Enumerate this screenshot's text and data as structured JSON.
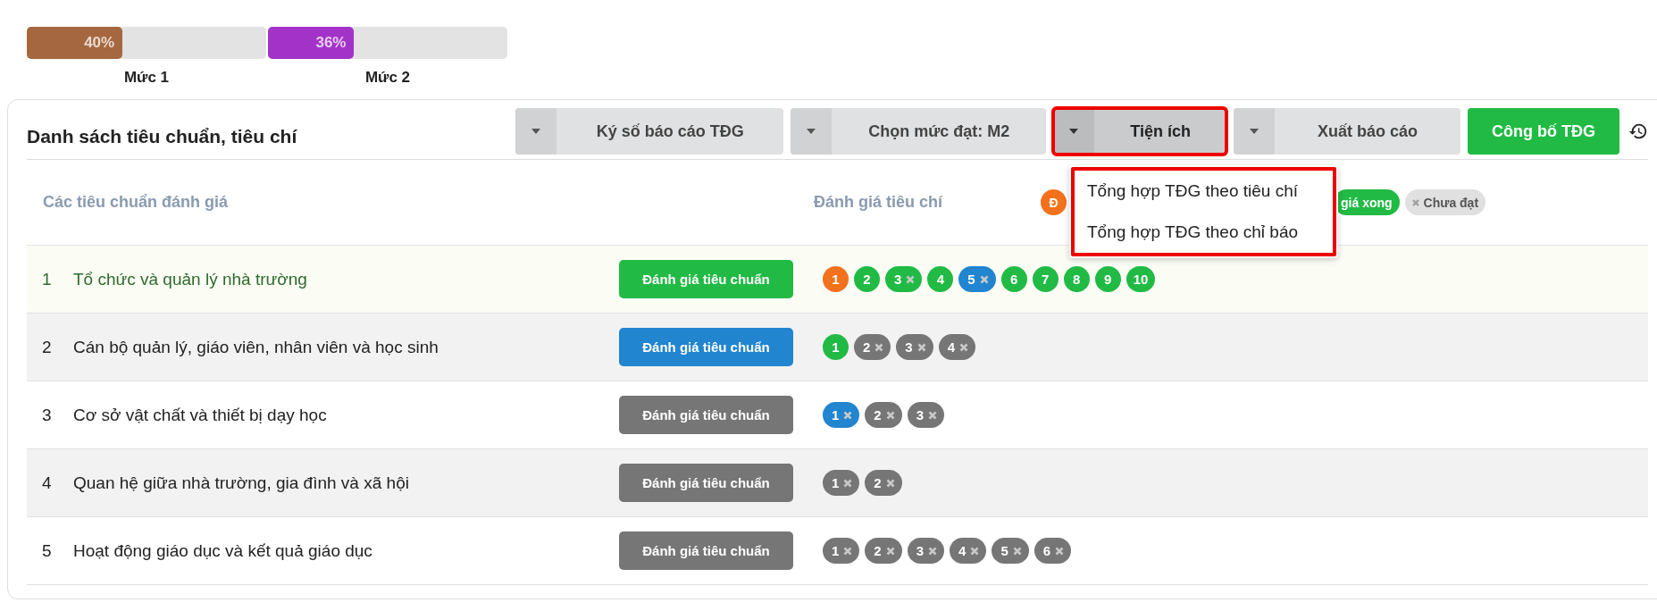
{
  "levels": [
    {
      "value": "40%",
      "level": 0.4,
      "color": "#a5673f",
      "label": "Mức 1"
    },
    {
      "value": "36%",
      "level": 0.36,
      "color": "#a333c8",
      "label": "Mức 2"
    }
  ],
  "panel": {
    "title": "Danh sách tiêu chuẩn, tiêu chí",
    "toolbar": [
      {
        "kind": "split",
        "label": "Ký số báo cáo TĐG",
        "expanded": false,
        "highlighted": false
      },
      {
        "kind": "split",
        "label": "Chọn mức đạt: M2",
        "expanded": false,
        "highlighted": false
      },
      {
        "kind": "split",
        "label": "Tiện ích",
        "expanded": true,
        "highlighted": true
      },
      {
        "kind": "split",
        "label": "Xuất báo cáo",
        "expanded": false,
        "highlighted": false
      },
      {
        "kind": "primary",
        "label": "Công bố TĐG"
      }
    ],
    "menu": {
      "highlighted": true,
      "items": [
        "Tổng hợp TĐG theo tiêu chí",
        "Tổng hợp TĐG theo chỉ báo"
      ]
    },
    "columns": [
      "Các tiêu chuẩn đánh giá",
      "Đánh giá tiêu chí"
    ],
    "legend": [
      {
        "label": "Đ",
        "color": "#f2711c",
        "crossed": false
      },
      {
        "label": "giá xong",
        "color": "#21ba45",
        "crossed": false
      },
      {
        "label": "Chưa đạt",
        "color": "#e0e0e0",
        "crossed": true
      }
    ],
    "rows": [
      {
        "index": "1",
        "name": "Tổ chức và quản lý nhà trường",
        "selected": true,
        "button": {
          "label": "Đánh giá tiêu chuẩn",
          "color": "#21ba45"
        },
        "criteria": [
          {
            "label": "1",
            "color": "#f2711c",
            "crossed": false
          },
          {
            "label": "2",
            "color": "#21ba45",
            "crossed": false
          },
          {
            "label": "3",
            "color": "#21ba45",
            "crossed": true
          },
          {
            "label": "4",
            "color": "#21ba45",
            "crossed": false
          },
          {
            "label": "5",
            "color": "#2185d0",
            "crossed": true
          },
          {
            "label": "6",
            "color": "#21ba45",
            "crossed": false
          },
          {
            "label": "7",
            "color": "#21ba45",
            "crossed": false
          },
          {
            "label": "8",
            "color": "#21ba45",
            "crossed": false
          },
          {
            "label": "9",
            "color": "#21ba45",
            "crossed": false
          },
          {
            "label": "10",
            "color": "#21ba45",
            "crossed": false
          }
        ]
      },
      {
        "index": "2",
        "name": "Cán bộ quản lý, giáo viên, nhân viên và học sinh",
        "selected": false,
        "button": {
          "label": "Đánh giá tiêu chuẩn",
          "color": "#2185d0"
        },
        "criteria": [
          {
            "label": "1",
            "color": "#21ba45",
            "crossed": false
          },
          {
            "label": "2",
            "color": "#767676",
            "crossed": true
          },
          {
            "label": "3",
            "color": "#767676",
            "crossed": true
          },
          {
            "label": "4",
            "color": "#767676",
            "crossed": true
          }
        ]
      },
      {
        "index": "3",
        "name": "Cơ sở vật chất và thiết bị dạy học",
        "selected": false,
        "button": {
          "label": "Đánh giá tiêu chuẩn",
          "color": "#767676"
        },
        "criteria": [
          {
            "label": "1",
            "color": "#2185d0",
            "crossed": true
          },
          {
            "label": "2",
            "color": "#767676",
            "crossed": true
          },
          {
            "label": "3",
            "color": "#767676",
            "crossed": true
          }
        ]
      },
      {
        "index": "4",
        "name": "Quan hệ giữa nhà trường, gia đình và xã hội",
        "selected": false,
        "button": {
          "label": "Đánh giá tiêu chuẩn",
          "color": "#767676"
        },
        "criteria": [
          {
            "label": "1",
            "color": "#767676",
            "crossed": true
          },
          {
            "label": "2",
            "color": "#767676",
            "crossed": true
          }
        ]
      },
      {
        "index": "5",
        "name": "Hoạt động giáo dục và kết quả giáo dục",
        "selected": false,
        "button": {
          "label": "Đánh giá tiêu chuẩn",
          "color": "#767676"
        },
        "criteria": [
          {
            "label": "1",
            "color": "#767676",
            "crossed": true
          },
          {
            "label": "2",
            "color": "#767676",
            "crossed": true
          },
          {
            "label": "3",
            "color": "#767676",
            "crossed": true
          },
          {
            "label": "4",
            "color": "#767676",
            "crossed": true
          },
          {
            "label": "5",
            "color": "#767676",
            "crossed": true
          },
          {
            "label": "6",
            "color": "#767676",
            "crossed": true
          }
        ]
      }
    ]
  }
}
